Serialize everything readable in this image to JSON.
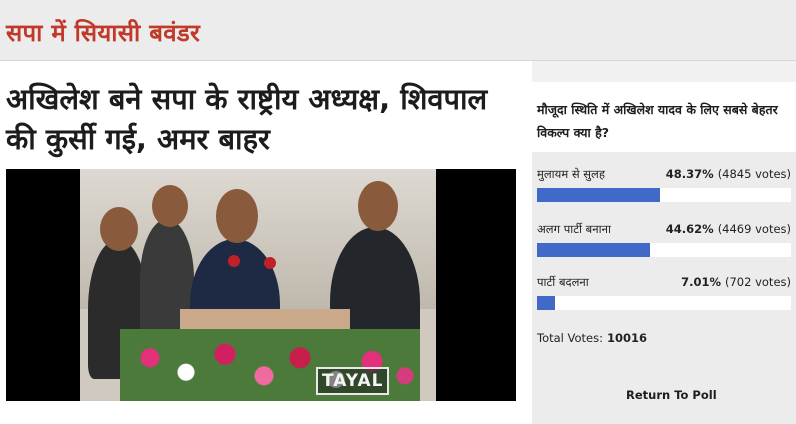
{
  "header": {
    "section_title": "सपा में सियासी बवंडर"
  },
  "article": {
    "headline": "अखिलेश बने सपा के राष्ट्रीय अध्यक्ष, शिवपाल की कुर्सी गई, अमर बाहर",
    "video_watermark": "TAYAL"
  },
  "poll": {
    "question": "मौजूदा स्थिति में अखिलेश यादव के लिए सबसे बेहतर विकल्प क्या है?",
    "bar_color": "#4069c8",
    "options": [
      {
        "label": "मुलायम से सुलह",
        "percent": "48.37%",
        "votes": "(4845 votes)",
        "fraction": 0.4837
      },
      {
        "label": "अलग पार्टी बनाना",
        "percent": "44.62%",
        "votes": "(4469 votes)",
        "fraction": 0.4462
      },
      {
        "label": "पार्टी बदलना",
        "percent": "7.01%",
        "votes": "(702 votes)",
        "fraction": 0.0701
      }
    ],
    "total_label": "Total Votes:",
    "total_value": "10016",
    "return_label": "Return To Poll"
  }
}
